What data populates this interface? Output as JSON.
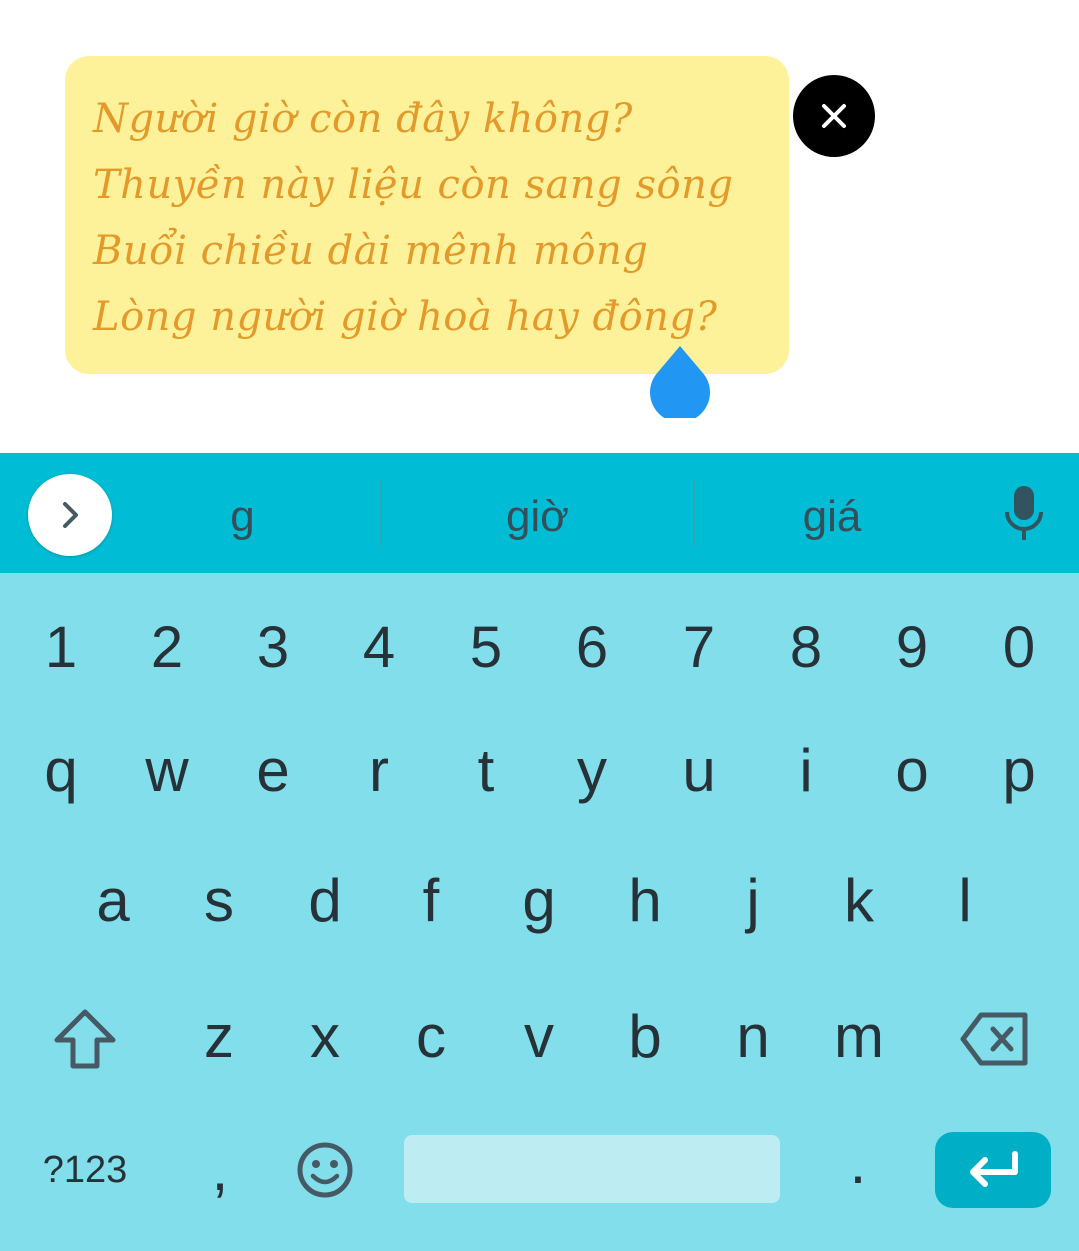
{
  "note": {
    "lines": [
      "Người giờ còn đây không?",
      "Thuyền này liệu còn sang sông",
      "Buổi chiều dài mênh mông",
      "Lòng người giờ hoà hay đông?"
    ],
    "background_color": "#FDF29A",
    "text_color": "#E39A2A"
  },
  "close_button": {
    "icon": "close-icon"
  },
  "text_cursor": {
    "icon": "cursor-handle-icon",
    "color": "#2196F3"
  },
  "keyboard": {
    "accent_color": "#00BCD4",
    "background_color": "#81DEEA",
    "suggestions": [
      "g",
      "giờ",
      "giá"
    ],
    "expand_icon": "chevron-right-icon",
    "mic_icon": "microphone-icon",
    "number_row": [
      "1",
      "2",
      "3",
      "4",
      "5",
      "6",
      "7",
      "8",
      "9",
      "0"
    ],
    "row1": [
      "q",
      "w",
      "e",
      "r",
      "t",
      "y",
      "u",
      "i",
      "o",
      "p"
    ],
    "row2": [
      "a",
      "s",
      "d",
      "f",
      "g",
      "h",
      "j",
      "k",
      "l"
    ],
    "row3": [
      "z",
      "x",
      "c",
      "v",
      "b",
      "n",
      "m"
    ],
    "shift_icon": "shift-icon",
    "backspace_icon": "backspace-icon",
    "symbols_label": "?123",
    "comma_label": ",",
    "emoji_icon": "emoji-icon",
    "period_label": ".",
    "enter_icon": "enter-icon"
  }
}
